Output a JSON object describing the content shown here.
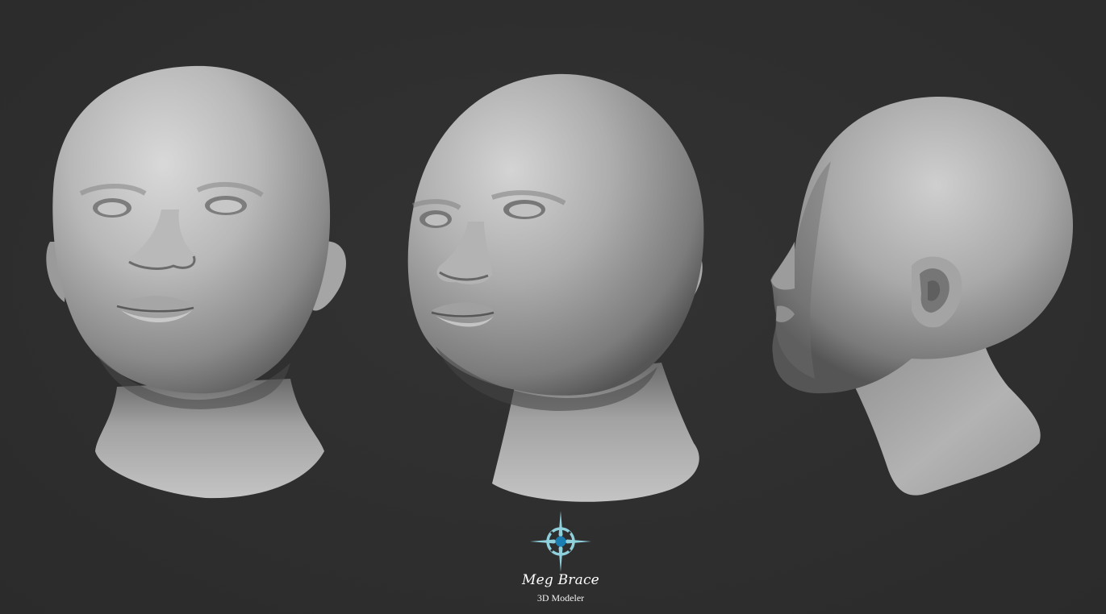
{
  "background_color": "#2f2f2f",
  "accent_color": "#8fd0dd",
  "logo_center_color": "#1a7fb0",
  "images": [
    {
      "name": "head-front-view",
      "icon": "sculpted-head-front"
    },
    {
      "name": "head-three-quarter-view",
      "icon": "sculpted-head-three-quarter"
    },
    {
      "name": "head-side-view",
      "icon": "sculpted-head-profile"
    }
  ],
  "signature": {
    "logo_icon": "compass-star-icon",
    "name": "Meg Brace",
    "role": "3D Modeler"
  }
}
